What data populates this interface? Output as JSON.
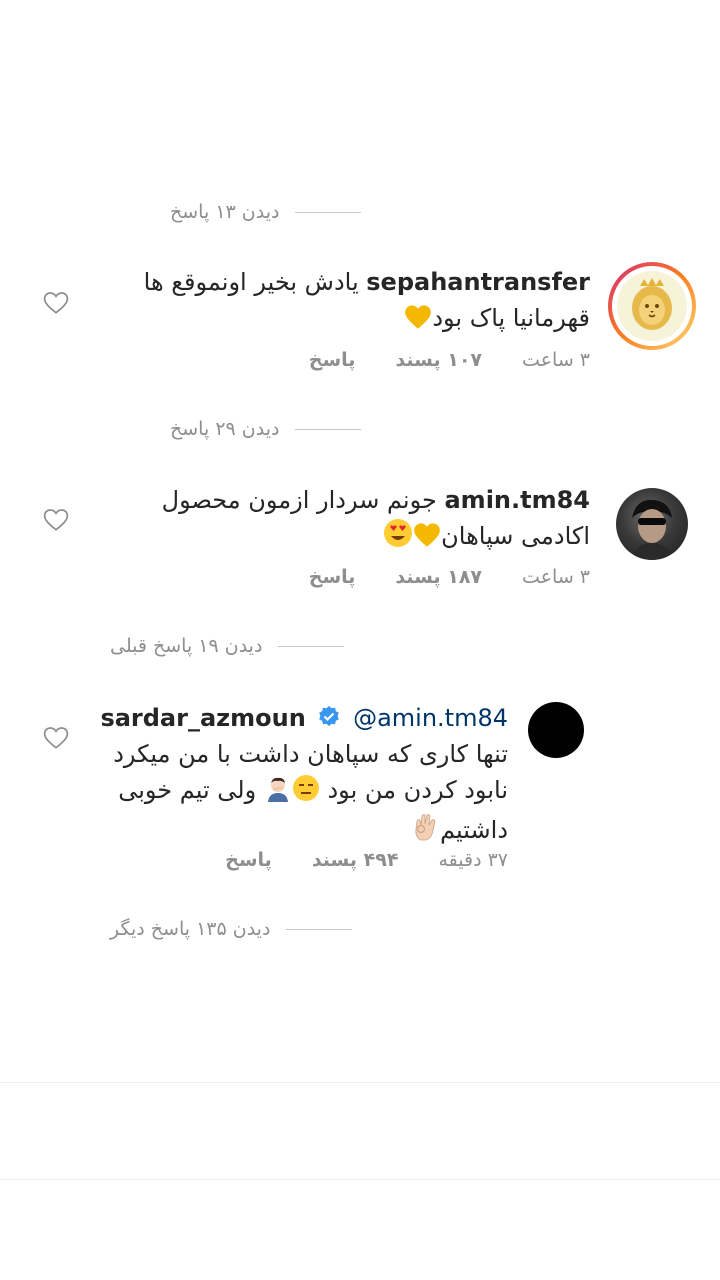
{
  "replies_toggle_1": "دیدن ۱۳ پاسخ",
  "comments": [
    {
      "username": "sepahantransfer",
      "text_line1": "یادش بخیر اونموقع ها",
      "text_line2": "قهرمانیا پاک بود",
      "time": "۳ ساعت",
      "likes": "۱۰۷ پسند",
      "reply": "پاسخ",
      "avatar": "sepahan-lion-logo"
    },
    {
      "username": "amin.tm84",
      "text_line1": "جونم سردار ازمون محصول",
      "text_line2": "اکادمی سپاهان",
      "time": "۳ ساعت",
      "likes": "۱۸۷ پسند",
      "reply": "پاسخ",
      "avatar": "user-photo"
    },
    {
      "username": "sardar_azmoun",
      "mention": "@amin.tm84",
      "text_line1": "تنها کاری که سپاهان داشت با من میکرد",
      "text_line2": "نابود کردن من بود",
      "text_line2b": "ولی تیم خوبی",
      "text_line3": "داشتیم",
      "time": "۳۷ دقیقه",
      "likes": "۴۹۴ پسند",
      "reply": "پاسخ",
      "avatar": "black-circle",
      "verified": true
    }
  ],
  "replies_toggle_2": "دیدن ۲۹ پاسخ",
  "replies_toggle_3": "دیدن ۱۹ پاسخ قبلی",
  "replies_toggle_4": "دیدن ۱۳۵ پاسخ دیگر",
  "colors": {
    "mention": "#003569",
    "secondary": "#8e8e8e",
    "verified": "#3897f0",
    "heart_emoji": "#f5b800"
  }
}
